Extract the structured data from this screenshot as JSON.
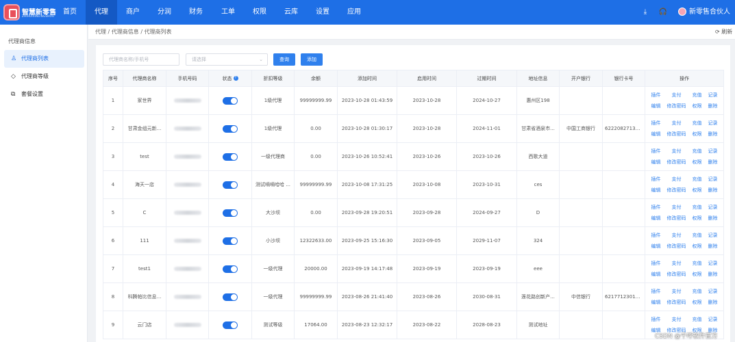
{
  "app": {
    "brand": "智慧新零售",
    "brand_sub": "ZHIHUIXINLINGSHOU",
    "user_name": "新零售合伙人"
  },
  "nav": [
    "首页",
    "代理",
    "商户",
    "分润",
    "财务",
    "工单",
    "权限",
    "云库",
    "设置",
    "应用"
  ],
  "nav_active": "代理",
  "icons": {
    "logo": "logo-icon",
    "download": "download-icon",
    "headset": "headset-icon",
    "refresh": "refresh-icon",
    "user": "user-icon",
    "level": "diamond-icon",
    "package": "package-icon",
    "help": "help-icon"
  },
  "colors": {
    "primary": "#1e6fe6",
    "link": "#2f80ed",
    "switch_on": "#1e6fe6"
  },
  "sidebar": {
    "title": "代理商信息",
    "items": [
      {
        "label": "代理商列表",
        "active": true
      },
      {
        "label": "代理商等级",
        "active": false
      },
      {
        "label": "套餐设置",
        "active": false
      }
    ]
  },
  "breadcrumb": "代理 / 代理商信息 / 代理商列表",
  "refresh_label": "刷新",
  "filters": {
    "search_placeholder": "代理商名称/手机号",
    "select_placeholder": "请选择",
    "query_label": "查询",
    "add_label": "添加"
  },
  "table": {
    "headers": [
      "序号",
      "代理商名称",
      "手机号码",
      "状态",
      "折扣等级",
      "余额",
      "添加时间",
      "启用时间",
      "过期时间",
      "地址信息",
      "开户银行",
      "银行卡号",
      "操作"
    ],
    "actions": [
      "插件",
      "支付",
      "充值",
      "记录",
      "编辑",
      "修改密码",
      "权限",
      "删除"
    ],
    "rows": [
      {
        "no": "1",
        "name": "家世界",
        "status": true,
        "level": "1级代理",
        "balance": "99999999.99",
        "added": "2023-10-28 01:43:59",
        "start": "2023-10-28",
        "expire": "2024-10-27",
        "address": "惠州区198",
        "bank": "",
        "card": ""
      },
      {
        "no": "2",
        "name": "甘肃金组元新...",
        "status": true,
        "level": "1级代理",
        "balance": "0.00",
        "added": "2023-10-28 01:30:17",
        "start": "2023-10-28",
        "expire": "2024-11-01",
        "address": "甘肃省酒泉市...",
        "bank": "中国工商银行",
        "card": "62220827130..."
      },
      {
        "no": "3",
        "name": "test",
        "status": true,
        "level": "一级代理商",
        "balance": "0.00",
        "added": "2023-10-26 10:52:41",
        "start": "2023-10-26",
        "expire": "2023-10-26",
        "address": "西歌大道",
        "bank": "",
        "card": ""
      },
      {
        "no": "4",
        "name": "海天一店",
        "status": true,
        "level": "测试嘀嘀哈哈 ...",
        "balance": "99999999.99",
        "added": "2023-10-08 17:31:25",
        "start": "2023-10-08",
        "expire": "2023-10-31",
        "address": "ces",
        "bank": "",
        "card": ""
      },
      {
        "no": "5",
        "name": "C",
        "status": true,
        "level": "大沙坝",
        "balance": "0.00",
        "added": "2023-09-28 19:20:51",
        "start": "2023-09-28",
        "expire": "2024-09-27",
        "address": "D",
        "bank": "",
        "card": ""
      },
      {
        "no": "6",
        "name": "111",
        "status": true,
        "level": "小沙坝",
        "balance": "12322633.00",
        "added": "2023-09-25 15:16:30",
        "start": "2023-09-05",
        "expire": "2029-11-07",
        "address": "324",
        "bank": "",
        "card": ""
      },
      {
        "no": "7",
        "name": "test1",
        "status": true,
        "level": "一级代理",
        "balance": "20000.00",
        "added": "2023-09-19 14:17:48",
        "start": "2023-09-19",
        "expire": "2023-09-19",
        "address": "eee",
        "bank": "",
        "card": ""
      },
      {
        "no": "8",
        "name": "科腾帕比信息...",
        "status": true,
        "level": "一级代理",
        "balance": "99999999.99",
        "added": "2023-08-26 21:41:40",
        "start": "2023-08-26",
        "expire": "2030-08-31",
        "address": "莲花路创新产...",
        "bank": "中信银行",
        "card": "62177123016..."
      },
      {
        "no": "9",
        "name": "云门店",
        "status": true,
        "level": "测试等级",
        "balance": "17064.00",
        "added": "2023-08-23 12:32:17",
        "start": "2023-08-22",
        "expire": "2028-08-23",
        "address": "测试地址",
        "bank": "",
        "card": ""
      }
    ]
  },
  "watermark": "CSDN @千呼软件官方"
}
